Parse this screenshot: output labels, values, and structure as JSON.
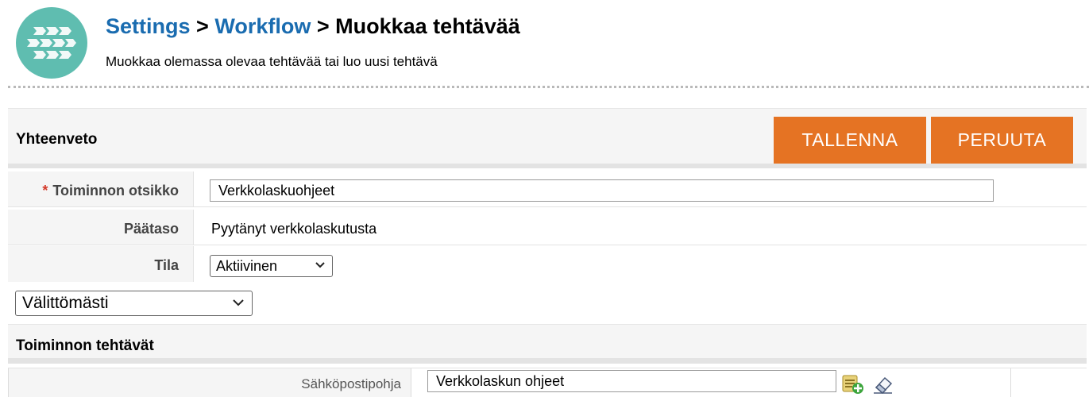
{
  "header": {
    "breadcrumb": {
      "settings": "Settings",
      "separator": ">",
      "workflow": "Workflow",
      "current": "Muokkaa tehtävää"
    },
    "subtitle": "Muokkaa olemassa olevaa tehtävää tai luo uusi tehtävä",
    "logo_icon": "workflow-chevrons-icon"
  },
  "summary": {
    "title": "Yhteenveto",
    "save_label": "TALLENNA",
    "cancel_label": "PERUUTA"
  },
  "form": {
    "required_marker": "*",
    "title_label": "Toiminnon otsikko",
    "title_value": "Verkkolaskuohjeet",
    "level_label": "Päätaso",
    "level_value": "Pyytänyt verkkolaskutusta",
    "status_label": "Tila",
    "status_value": "Aktiivinen"
  },
  "timing_select": {
    "value": "Välittömästi"
  },
  "tasks": {
    "title": "Toiminnon tehtävät",
    "template_label": "Sähköpostipohja",
    "template_value": "Verkkolaskun ohjeet",
    "add_icon": "add-template-icon",
    "clear_icon": "eraser-icon"
  },
  "colors": {
    "accent": "#e57323",
    "link": "#1a6cb0",
    "logo": "#5fbdb0",
    "required": "#d43a2b"
  }
}
